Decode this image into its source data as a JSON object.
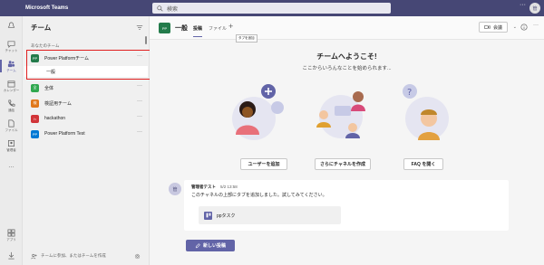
{
  "app": {
    "title": "Microsoft Teams",
    "search_placeholder": "検索",
    "avatar_initial": "管"
  },
  "rail": [
    {
      "label": "",
      "icon": "activity-icon"
    },
    {
      "label": "チャット",
      "icon": "chat-icon"
    },
    {
      "label": "チーム",
      "icon": "teams-icon",
      "active": true
    },
    {
      "label": "カレンダー",
      "icon": "calendar-icon"
    },
    {
      "label": "通話",
      "icon": "call-icon"
    },
    {
      "label": "ファイル",
      "icon": "files-icon"
    },
    {
      "label": "管理者",
      "icon": "admin-icon"
    },
    {
      "label": "…",
      "icon": "more-icon"
    }
  ],
  "rail_bottom": {
    "apps_label": "アプリ",
    "help_label": "ヘルプ"
  },
  "panel": {
    "title": "チーム",
    "section_label": "あなたのチーム",
    "teams": [
      {
        "name": "Power Platformチーム",
        "initial": "PP",
        "color": "#237b4b"
      },
      {
        "name": "全体",
        "initial": "全",
        "color": "#2fa84f"
      },
      {
        "name": "検証用チーム",
        "initial": "検",
        "color": "#e0781b"
      },
      {
        "name": "hackathon",
        "initial": "h",
        "color": "#d13438"
      },
      {
        "name": "Power Platform Test",
        "initial": "PP",
        "color": "#0078d4"
      }
    ],
    "selected_channel": "一般",
    "footer": "チームに参加、またはチームを作成"
  },
  "header": {
    "team_initial": "PP",
    "channel": "一般",
    "tabs": [
      "投稿",
      "ファイル"
    ],
    "add_tab_tooltip": "タブを追加",
    "meet_label": "会議"
  },
  "welcome": {
    "title": "チームへようこそ!",
    "subtitle": "ここからいろんなことを始められます...",
    "actions": [
      "ユーザーを追加",
      "さらにチャネルを作成",
      "FAQ を開く"
    ]
  },
  "message": {
    "avatar": "管",
    "author": "管理者テスト",
    "time": "5/2 13:58",
    "text": "このチャネルの上部にタブを追加しました。試してみてください。",
    "tab_name": "ppタスク"
  },
  "new_post": "新しい投稿",
  "colors": {
    "brand": "#6264a7",
    "titlebar": "#464775",
    "highlight": "#e01e1e"
  }
}
